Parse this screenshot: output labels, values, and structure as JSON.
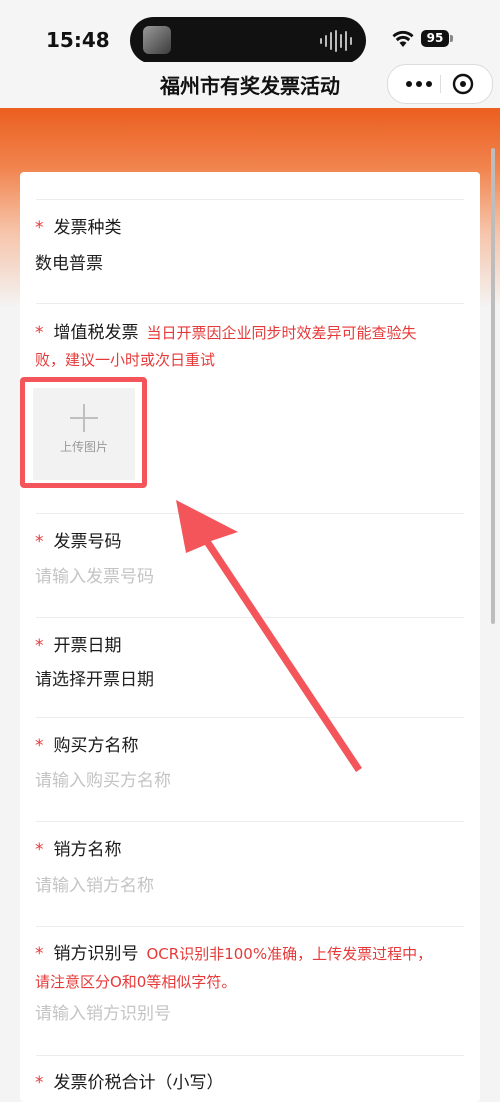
{
  "status_bar": {
    "time": "15:48",
    "battery": "95"
  },
  "nav": {
    "title": "福州市有奖发票活动"
  },
  "form": {
    "invoice_type": {
      "label": "发票种类",
      "value": "数电普票"
    },
    "vat_invoice": {
      "label": "增值税发票",
      "hint_line1": "当日开票因企业同步时效差异可能查验失",
      "hint_line2": "败，建议一小时或次日重试",
      "upload_label": "上传图片"
    },
    "invoice_number": {
      "label": "发票号码",
      "placeholder": "请输入发票号码"
    },
    "invoice_date": {
      "label": "开票日期",
      "value": "请选择开票日期"
    },
    "buyer_name": {
      "label": "购买方名称",
      "placeholder": "请输入购买方名称"
    },
    "seller_name": {
      "label": "销方名称",
      "placeholder": "请输入销方名称"
    },
    "seller_tax_id": {
      "label": "销方识别号",
      "hint_line1": "OCR识别非100%准确，上传发票过程中，",
      "hint_line2": "请注意区分O和0等相似字符。",
      "placeholder": "请输入销方识别号"
    },
    "total_amount": {
      "label": "发票价税合计（小写）"
    }
  },
  "colors": {
    "accent": "#eb5f1f",
    "required_star": "#e63a3a",
    "annotation": "#f3555a"
  }
}
